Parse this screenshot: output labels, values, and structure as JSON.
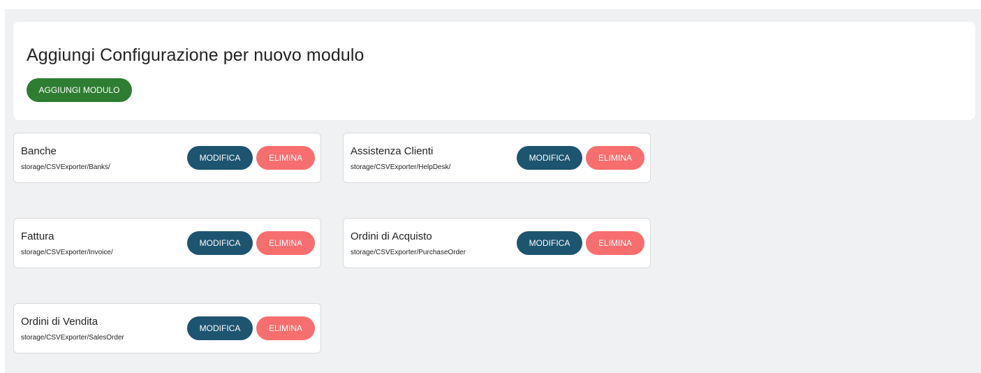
{
  "header": {
    "title": "Aggiungi Configurazione per nuovo modulo",
    "add_button_label": "AGGIUNGI MODULO"
  },
  "actions": {
    "edit_label": "MODIFICA",
    "delete_label": "ELIMINA"
  },
  "modules": [
    {
      "name": "Banche",
      "path": "storage/CSVExporter/Banks/"
    },
    {
      "name": "Assistenza Clienti",
      "path": "storage/CSVExporter/HelpDesk/"
    },
    {
      "name": "Fattura",
      "path": "storage/CSVExporter/Invoice/"
    },
    {
      "name": "Ordini di Acquisto",
      "path": "storage/CSVExporter/PurchaseOrder"
    },
    {
      "name": "Ordini di Vendita",
      "path": "storage/CSVExporter/SalesOrder"
    }
  ],
  "colors": {
    "add_button": "#2e7d32",
    "edit_button": "#1d5470",
    "delete_button": "#f76e6e",
    "background": "#f0f1f3"
  }
}
